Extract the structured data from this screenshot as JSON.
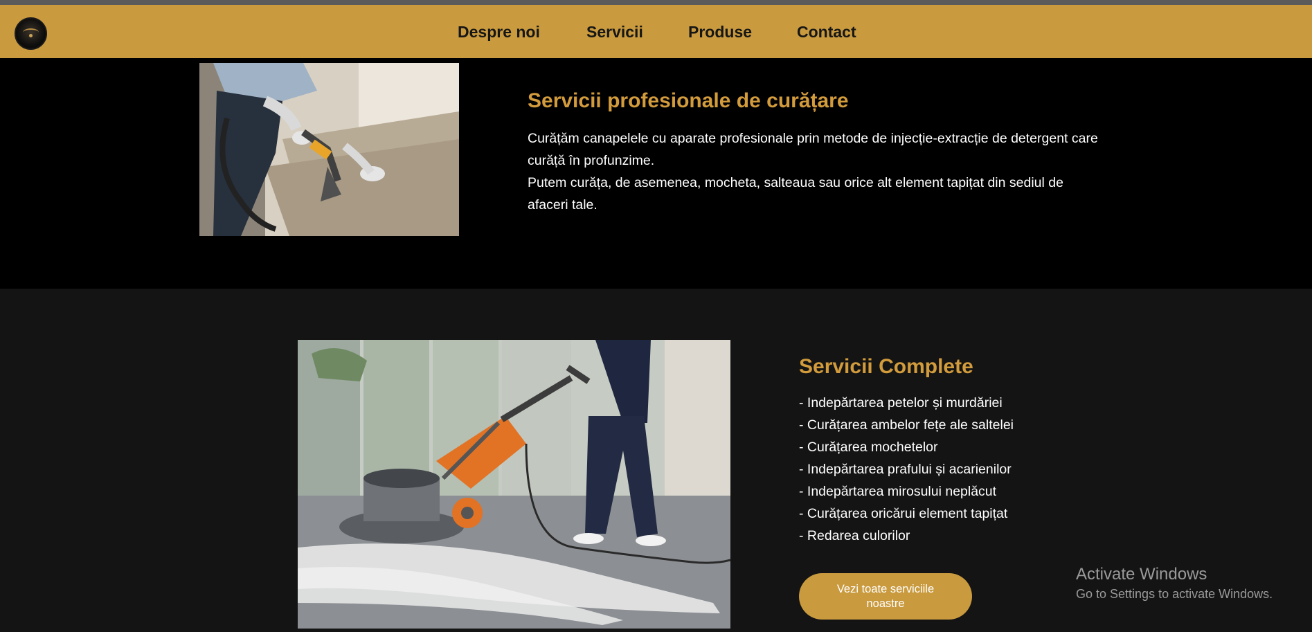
{
  "header": {
    "logo_alt": "logo",
    "nav": [
      {
        "label": "Despre noi"
      },
      {
        "label": "Servicii"
      },
      {
        "label": "Produse"
      },
      {
        "label": "Contact"
      }
    ]
  },
  "section_professional": {
    "title": "Servicii profesionale de curățare",
    "paragraph_lines": [
      "Curățăm canapelele cu aparate profesionale prin metode de injecție-extracție de detergent care",
      "curăță în profunzime.",
      "Putem curăța, de asemenea, mocheta, salteaua sau orice alt element tapițat din sediul de",
      "afaceri tale."
    ]
  },
  "section_complete": {
    "title": "Servicii Complete",
    "items": [
      "- Indepărtarea petelor și murdăriei",
      "- Curățarea ambelor fețe ale saltelei",
      "- Curățarea mochetelor",
      "- Indepărtarea prafului și acarienilor",
      "- Indepărtarea mirosului neplăcut",
      "- Curățarea oricărui element tapițat",
      "- Redarea culorilor"
    ],
    "cta_label": "Vezi toate serviciile noastre"
  },
  "watermark": {
    "title": "Activate Windows",
    "subtitle": "Go to Settings to activate Windows."
  },
  "colors": {
    "accent": "#c99a3e",
    "heading": "#d29b3c",
    "section_dark": "#000000",
    "section_gray": "#141414"
  }
}
